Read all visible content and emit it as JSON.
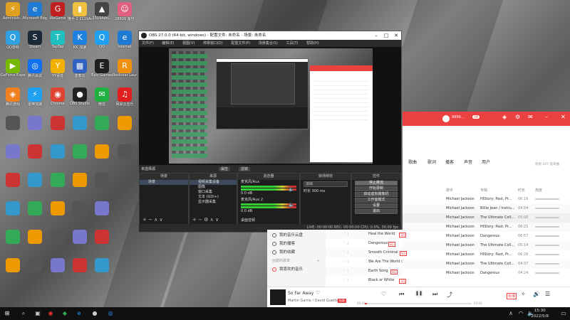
{
  "desktop": {
    "icons": [
      {
        "label": "Administr...",
        "glyph": "⚡",
        "color": "#e0a020"
      },
      {
        "label": "Microsoft Edge",
        "glyph": "e",
        "color": "#1f7ad4"
      },
      {
        "label": "WeGame",
        "glyph": "G",
        "color": "#c02020"
      },
      {
        "label": "猫手 2 2119Adn...",
        "glyph": "▮",
        "color": "#f0c040"
      },
      {
        "label": "2019Adn...",
        "glyph": "▲",
        "color": "#444"
      },
      {
        "label": "28826 备份",
        "glyph": "☺",
        "color": "#e06080"
      },
      {
        "label": "QQ游戏",
        "glyph": "Q",
        "color": "#30a0e0"
      },
      {
        "label": "Steam",
        "glyph": "S",
        "color": "#1b2838"
      },
      {
        "label": "TapTap",
        "glyph": "T",
        "color": "#20c0c0"
      },
      {
        "label": "KK 加速",
        "glyph": "K",
        "color": "#2080e0"
      },
      {
        "label": "QQ",
        "glyph": "Q",
        "color": "#20a0f0"
      },
      {
        "label": "Internet",
        "glyph": "e",
        "color": "#1f7ad4"
      },
      {
        "label": "GeForce Experience",
        "glyph": "▶",
        "color": "#76b900"
      },
      {
        "label": "腾讯会议",
        "glyph": "◎",
        "color": "#1070f0"
      },
      {
        "label": "YY语音",
        "glyph": "Y",
        "color": "#f0b000"
      },
      {
        "label": "蓝奏云",
        "glyph": "▦",
        "color": "#3060c0"
      },
      {
        "label": "Epic Games",
        "glyph": "E",
        "color": "#202020"
      },
      {
        "label": "Rockstar Launcher",
        "glyph": "R",
        "color": "#f09010"
      },
      {
        "label": "腾讯游戏",
        "glyph": "◈",
        "color": "#f08020"
      },
      {
        "label": "雷神加速",
        "glyph": "⚡",
        "color": "#20a0f0"
      },
      {
        "label": "Chrome",
        "glyph": "◉",
        "color": "#dd4433"
      },
      {
        "label": "OBS Studio",
        "glyph": "●",
        "color": "#222"
      },
      {
        "label": "微信",
        "glyph": "✉",
        "color": "#20b040"
      },
      {
        "label": "网易云音乐",
        "glyph": "♫",
        "color": "#e02020"
      }
    ]
  },
  "obs": {
    "title": "OBS 27.0.0 (64-bit, windows) - 配置文件: 未命名 - 场景: 未命名",
    "menu": [
      "文件(F)",
      "编辑(E)",
      "视图(V)",
      "停靠窗口(D)",
      "配置文件(P)",
      "场景集合(S)",
      "工具(T)",
      "帮助(H)"
    ],
    "status_label": "未选择源",
    "strip_buttons": [
      "属性",
      "滤镜"
    ],
    "scenes_header": "场景",
    "scenes": [
      "场景"
    ],
    "sources_header": "来源",
    "sources": [
      "视频采集设备",
      "图像",
      "窗口采集",
      "文本 (GDI+)",
      "显示器采集"
    ],
    "mixer_header": "混音器",
    "mixer_channels": [
      {
        "name": "麦克风/Aux",
        "level": "0.0 dB"
      },
      {
        "name": "麦克风/Aux 2",
        "level": "0.0 dB"
      }
    ],
    "mixer_hint": "桌面音频",
    "transitions_header": "转场特效",
    "transition_value": "淡出",
    "duration_label": "时长",
    "duration_value": "300 ms",
    "controls_header": "控件",
    "controls": [
      "停止推流",
      "开始录制",
      "启动虚拟摄像机",
      "工作室模式",
      "设置",
      "退出"
    ],
    "statusbar": "LIVE: 00:00:00   REC: 00:00:00   CPU: 0.0%, 30.00 fps"
  },
  "music": {
    "user": "9999...",
    "vip": "VIP",
    "tabs": [
      "歌曲",
      "歌词",
      "播客",
      "声音",
      "用户"
    ],
    "found": "找到 247 首单曲",
    "col_headers": {
      "album": "专辑",
      "duration": "时长",
      "hot": "热度",
      "artist": "歌手"
    },
    "rows_right": [
      {
        "artist": "Michael Jackson",
        "album": "HIStory: Past, Pr...",
        "duration": "06:16"
      },
      {
        "artist": "Michael Jackson",
        "album": "Billie Jean / Instru...",
        "duration": "04:54"
      },
      {
        "artist": "Michael Jackson",
        "album": "The Ultimate Coll...",
        "duration": "05:00"
      },
      {
        "artist": "Michael Jackson",
        "album": "HIStory: Past, Pr...",
        "duration": "06:21"
      },
      {
        "artist": "Michael Jackson",
        "album": "Dangerous",
        "duration": "06:57"
      },
      {
        "artist": "Michael Jackson",
        "album": "The Ultimate Coll...",
        "duration": "05:14"
      },
      {
        "artist": "Michael Jackson",
        "album": "HIStory: Past, Pr...",
        "duration": "06:26"
      },
      {
        "artist": "Michael Jackson",
        "album": "The Ultimate Coll...",
        "duration": "04:37"
      },
      {
        "artist": "Michael Jackson",
        "album": "Dangerous",
        "duration": "04:24"
      }
    ],
    "rows_left": [
      {
        "title": "Heal the World",
        "tag": "SQ"
      },
      {
        "title": "Dangerous",
        "tag": "SQ"
      },
      {
        "title": "Smooth Criminal",
        "tag": "SQ"
      },
      {
        "title": "We Are The World (Demo)",
        "tag": ""
      },
      {
        "title": "Earth Song",
        "tag": "SQ"
      },
      {
        "title": "Black or White",
        "tag": "SQ"
      }
    ],
    "sidebar": [
      "我的音乐云盘",
      "我的播客",
      "我的收藏"
    ],
    "sidebar_section": "创建的歌单",
    "sidebar_fav": "我喜欢的音乐",
    "player": {
      "song": "So Far Away",
      "artist": "Martin Garrix / David Guetta",
      "time_now": "00:01",
      "time_total": "03:03",
      "quality": "标准"
    }
  },
  "taskbar": {
    "time": "15:30",
    "date": "2022/5/8"
  }
}
